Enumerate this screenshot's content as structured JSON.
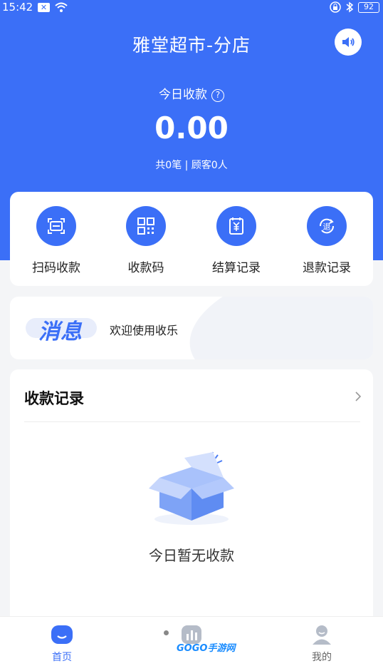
{
  "status_bar": {
    "time": "15:42",
    "battery": "92"
  },
  "header": {
    "store_title": "雅堂超市-分店",
    "today_label": "今日收款",
    "help_glyph": "?",
    "today_amount": "0.00",
    "today_summary": "共0笔 | 顾客0人"
  },
  "actions": [
    {
      "label": "扫码收款",
      "icon": "scan-icon"
    },
    {
      "label": "收款码",
      "icon": "qrcode-icon"
    },
    {
      "label": "结算记录",
      "icon": "settlement-icon"
    },
    {
      "label": "退款记录",
      "icon": "refund-icon"
    }
  ],
  "message": {
    "badge": "消息",
    "text": "欢迎使用收乐"
  },
  "records": {
    "title": "收款记录",
    "empty_text": "今日暂无收款"
  },
  "tabbar": {
    "home_label": "首页",
    "mine_label": "我的"
  },
  "watermark": "GOGO手游网",
  "colors": {
    "primary": "#3b6ff7",
    "background": "#f4f5f7"
  }
}
